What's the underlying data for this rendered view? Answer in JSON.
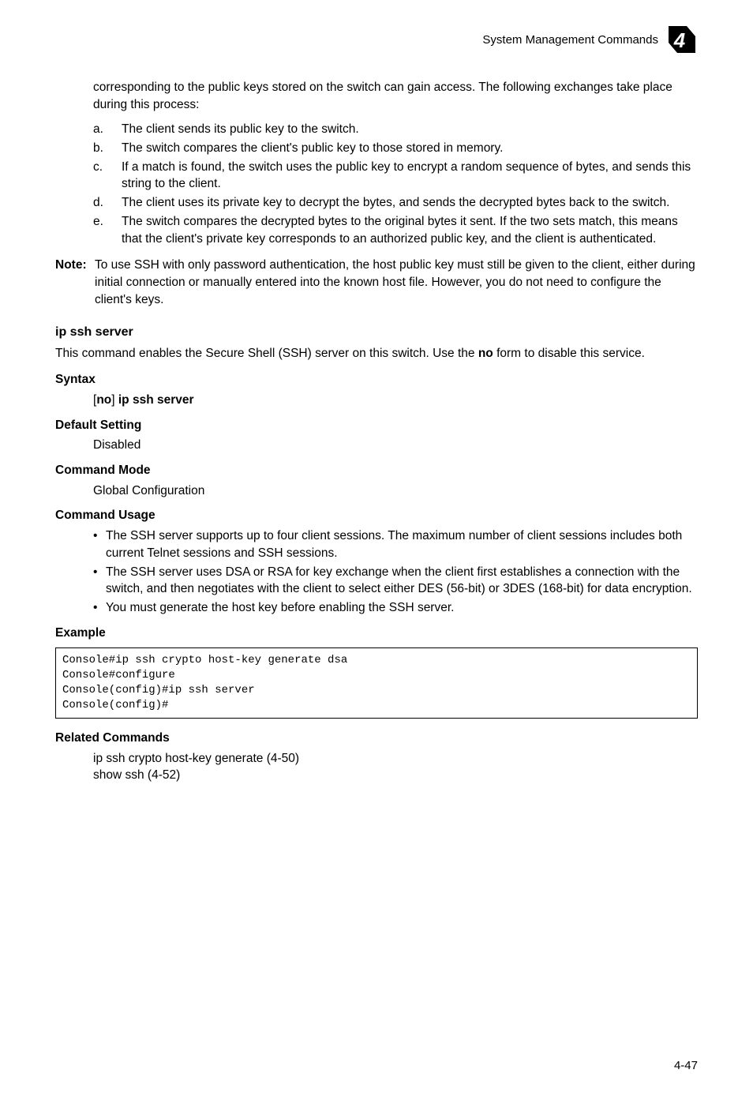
{
  "header": {
    "title": "System Management Commands",
    "chapter": "4"
  },
  "intro": {
    "para": "corresponding to the public keys stored on the switch can gain access. The following exchanges take place during this process:"
  },
  "steps": [
    {
      "marker": "a.",
      "text": "The client sends its public key to the switch."
    },
    {
      "marker": "b.",
      "text": "The switch compares the client's public key to those stored in memory."
    },
    {
      "marker": "c.",
      "text": "If a match is found, the switch uses the public key to encrypt a random sequence of bytes, and sends this string to the client."
    },
    {
      "marker": "d.",
      "text": "The client uses its private key to decrypt the bytes, and sends the decrypted bytes back to the switch."
    },
    {
      "marker": "e.",
      "text": "The switch compares the decrypted bytes to the original bytes it sent. If the two sets match, this means that the client's private key corresponds to an authorized public key, and the client is authenticated."
    }
  ],
  "note": {
    "label": "Note:",
    "text": "To use SSH with only password authentication, the host public key must still be given to the client, either during initial connection or manually entered into the known host file. However, you do not need to configure the client's keys."
  },
  "ipssh": {
    "heading": "ip ssh server",
    "desc_pre": "This command enables the Secure Shell (SSH) server on this switch. Use the ",
    "desc_bold": "no",
    "desc_post": " form to disable this service."
  },
  "syntax": {
    "heading": "Syntax",
    "bracket_open": "[",
    "no": "no",
    "bracket_close": "] ",
    "cmd": "ip ssh server"
  },
  "default": {
    "heading": "Default Setting",
    "value": "Disabled"
  },
  "mode": {
    "heading": "Command Mode",
    "value": "Global Configuration"
  },
  "usage": {
    "heading": "Command Usage",
    "bullets": [
      "The SSH server supports up to four client sessions. The maximum number of client sessions includes both current Telnet sessions and SSH sessions.",
      "The SSH server uses DSA or RSA for key exchange when the client first establishes a connection with the switch, and then negotiates with the client to select either DES (56-bit) or 3DES (168-bit) for data encryption.",
      "You must generate the host key before enabling the SSH server."
    ]
  },
  "example": {
    "heading": "Example",
    "code": "Console#ip ssh crypto host-key generate dsa\nConsole#configure\nConsole(config)#ip ssh server\nConsole(config)#"
  },
  "related": {
    "heading": "Related Commands",
    "lines": [
      "ip ssh crypto host-key generate (4-50)",
      "show ssh (4-52)"
    ]
  },
  "page": "4-47"
}
